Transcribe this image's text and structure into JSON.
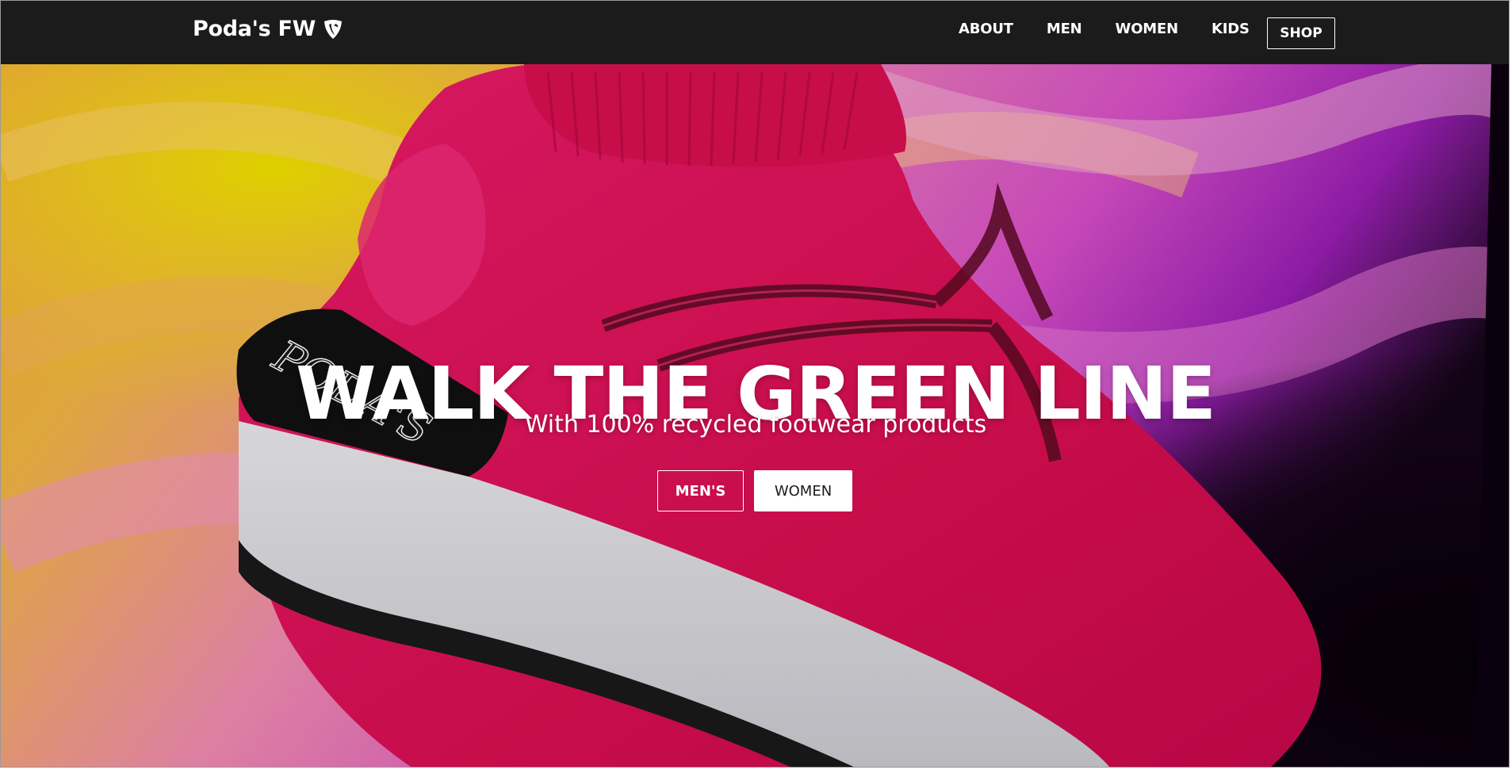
{
  "brand": {
    "name": "Poda's FW",
    "icon": "typo3-shield-icon"
  },
  "nav": {
    "items": [
      {
        "label": "ABOUT"
      },
      {
        "label": "MEN"
      },
      {
        "label": "WOMEN"
      },
      {
        "label": "KIDS"
      }
    ],
    "shop_label": "SHOP"
  },
  "hero": {
    "title": "WALK THE GREEN LINE",
    "subtitle": "With 100% recycled footwear products",
    "buttons": {
      "mens_label": "MEN'S",
      "women_label": "WOMEN"
    },
    "shoe_logo_text": "PODA'S"
  },
  "colors": {
    "navbar": "#1b1b1b",
    "shoe": "#e0105a",
    "text": "#ffffff"
  }
}
